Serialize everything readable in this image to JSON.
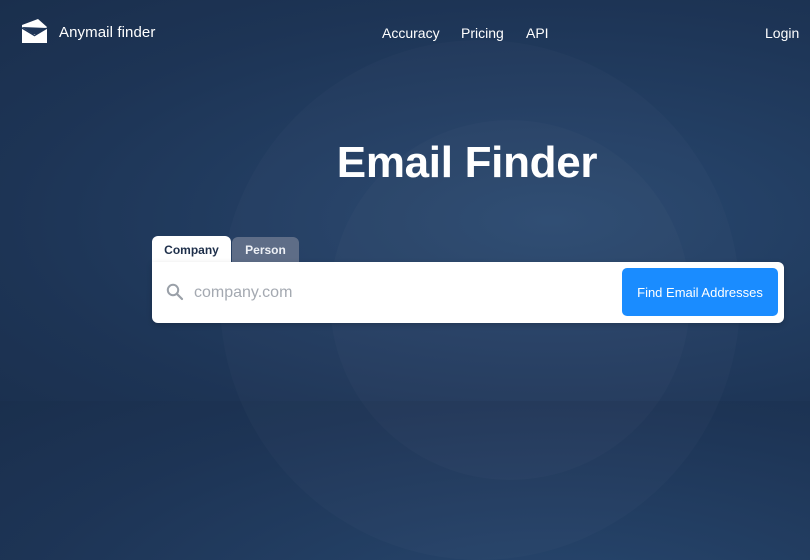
{
  "header": {
    "brand": "Anymail finder",
    "logo_icon": "envelope-icon",
    "nav": [
      {
        "label": "Accuracy"
      },
      {
        "label": "Pricing"
      },
      {
        "label": "API"
      }
    ],
    "login_label": "Login"
  },
  "hero": {
    "title": "Email Finder"
  },
  "search": {
    "tabs": [
      {
        "label": "Company",
        "active": true
      },
      {
        "label": "Person",
        "active": false
      }
    ],
    "placeholder": "company.com",
    "value": "",
    "button_label": "Find Email Addresses",
    "icon": "search-icon"
  },
  "colors": {
    "background": "#1f3658",
    "button": "#1a8cff",
    "inactive_tab": "#5e6d87"
  }
}
